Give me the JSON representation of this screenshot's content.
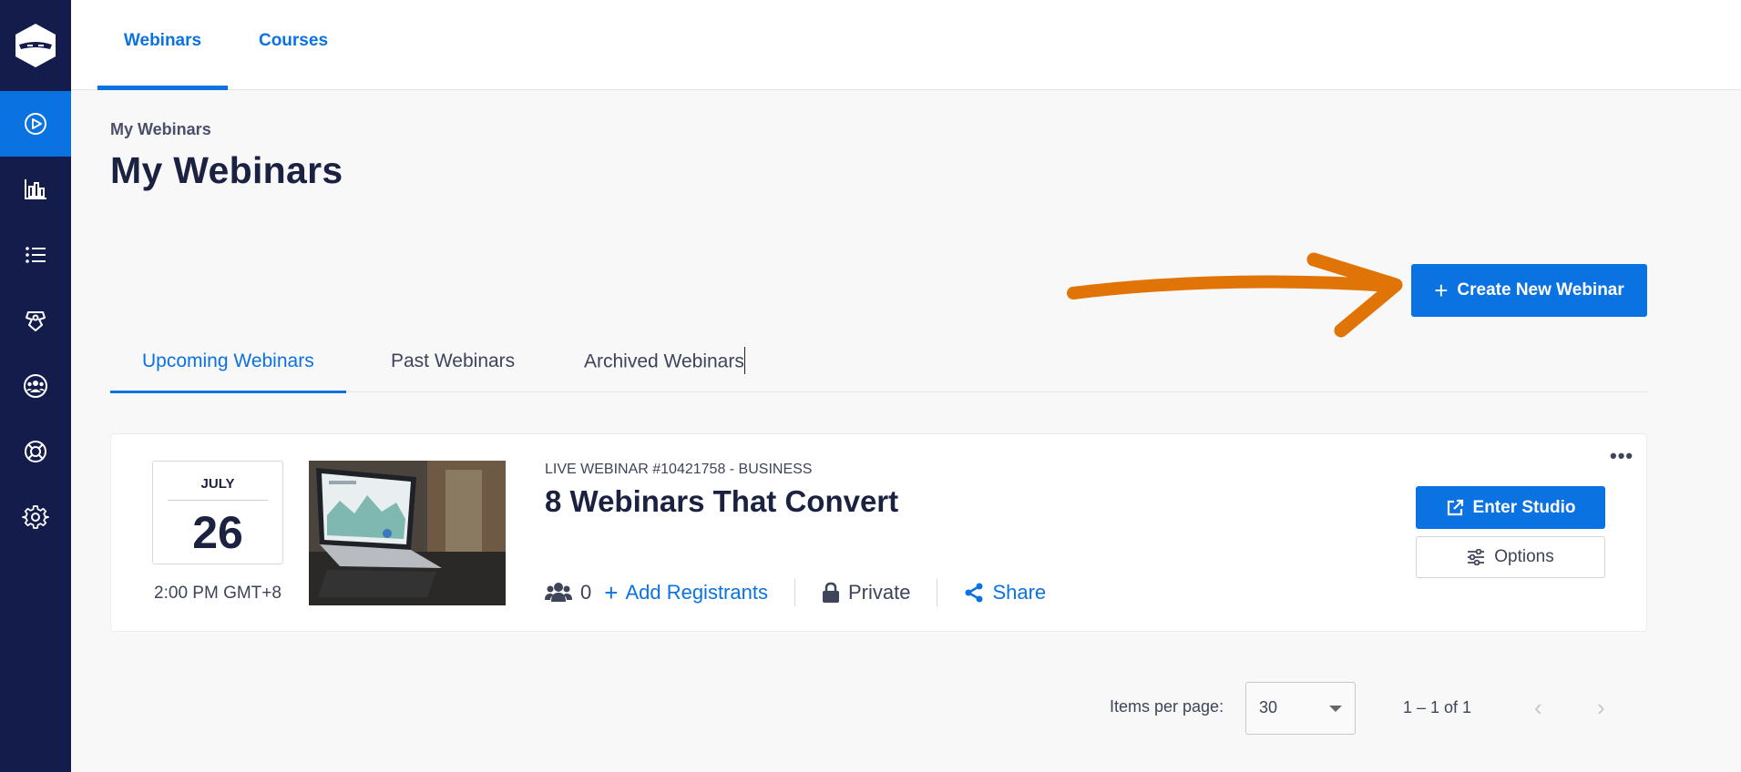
{
  "sidebar": {
    "logo_icon": "ninja-logo-icon",
    "items": [
      {
        "icon": "play-circle-icon",
        "active": true
      },
      {
        "icon": "bar-chart-icon",
        "active": false
      },
      {
        "icon": "list-icon",
        "active": false
      },
      {
        "icon": "integrations-icon",
        "active": false
      },
      {
        "icon": "team-icon",
        "active": false
      },
      {
        "icon": "lifebuoy-icon",
        "active": false
      },
      {
        "icon": "gear-icon",
        "active": false
      }
    ]
  },
  "topnav": {
    "tabs": [
      {
        "label": "Webinars",
        "active": true
      },
      {
        "label": "Courses",
        "active": false
      }
    ]
  },
  "header": {
    "breadcrumb": "My Webinars",
    "title": "My Webinars"
  },
  "actions": {
    "create_label": "Create New Webinar"
  },
  "subtabs": [
    {
      "label": "Upcoming Webinars",
      "active": true
    },
    {
      "label": "Past Webinars",
      "active": false
    },
    {
      "label": "Archived Webinars",
      "active": false
    }
  ],
  "webinar": {
    "month": "JULY",
    "day": "26",
    "time": "2:00 PM GMT+8",
    "meta": "LIVE WEBINAR #10421758 - BUSINESS",
    "title": "8 Webinars That Convert",
    "registrant_count": "0",
    "add_registrants": "Add Registrants",
    "privacy": "Private",
    "share": "Share",
    "enter_studio": "Enter Studio",
    "options": "Options"
  },
  "pagination": {
    "items_per_page_label": "Items per page:",
    "items_per_page": "30",
    "range": "1 – 1 of 1"
  },
  "colors": {
    "sidebar": "#141c4b",
    "accent": "#0b72e2",
    "annotation_arrow": "#e07406"
  }
}
